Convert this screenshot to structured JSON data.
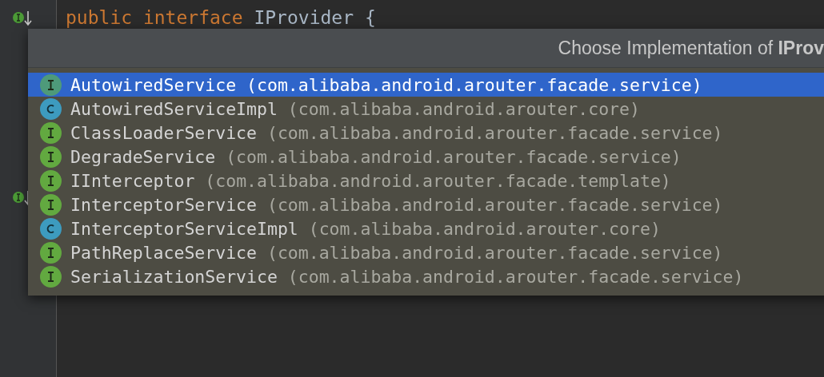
{
  "editor": {
    "code_line": [
      {
        "kind": "keyword",
        "text": "public interface"
      },
      {
        "kind": "plain",
        "text": " IProvider {"
      }
    ]
  },
  "popup": {
    "title": "Choose Implementation of **IProv**",
    "items": [
      {
        "kind": "interface",
        "name": "AutowiredService",
        "package": "(com.alibaba.android.arouter.facade.service)",
        "selected": true
      },
      {
        "kind": "class",
        "name": "AutowiredServiceImpl",
        "package": "(com.alibaba.android.arouter.core)",
        "selected": false
      },
      {
        "kind": "interface",
        "name": "ClassLoaderService",
        "package": "(com.alibaba.android.arouter.facade.service)",
        "selected": false
      },
      {
        "kind": "interface",
        "name": "DegradeService",
        "package": "(com.alibaba.android.arouter.facade.service)",
        "selected": false
      },
      {
        "kind": "interface",
        "name": "IInterceptor",
        "package": "(com.alibaba.android.arouter.facade.template)",
        "selected": false
      },
      {
        "kind": "interface",
        "name": "InterceptorService",
        "package": "(com.alibaba.android.arouter.facade.service)",
        "selected": false
      },
      {
        "kind": "class",
        "name": "InterceptorServiceImpl",
        "package": "(com.alibaba.android.arouter.core)",
        "selected": false
      },
      {
        "kind": "interface",
        "name": "PathReplaceService",
        "package": "(com.alibaba.android.arouter.facade.service)",
        "selected": false
      },
      {
        "kind": "interface",
        "name": "SerializationService",
        "package": "(com.alibaba.android.arouter.facade.service)",
        "selected": false
      }
    ]
  }
}
